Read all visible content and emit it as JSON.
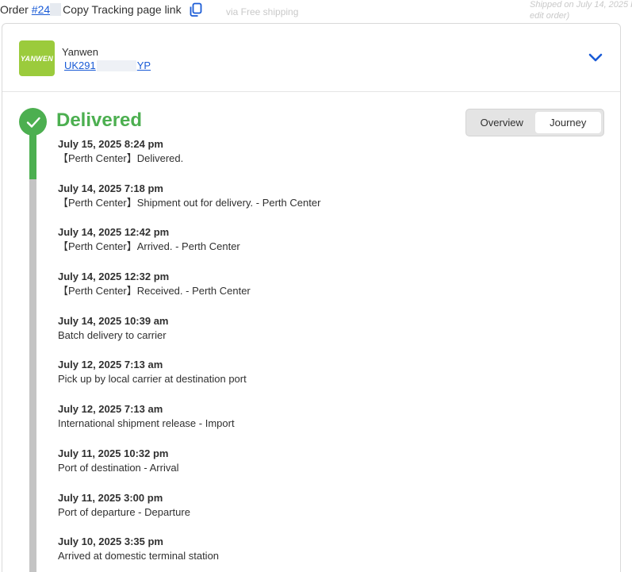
{
  "topbar": {
    "order_label": "Order",
    "order_number": "#24",
    "copy_label": "Copy Tracking page link",
    "copy_icon": "copy-icon"
  },
  "background": {
    "shipping_hint": "via Free shipping",
    "shipped_line1": "Shipped on July 14, 2025 by",
    "shipped_line2": "edit order)"
  },
  "carrier": {
    "logo_text": "YANWEN",
    "name": "Yanwen",
    "tracking_prefix": "UK291",
    "tracking_suffix": "YP",
    "accent_color": "#9bcb3c"
  },
  "status": {
    "title": "Delivered",
    "color": "#4caf50",
    "icon": "check-icon"
  },
  "view_toggle": {
    "overview": "Overview",
    "journey": "Journey",
    "selected": "Journey"
  },
  "events": [
    {
      "time": "July 15, 2025 8:24 pm",
      "desc": "【Perth Center】Delivered."
    },
    {
      "time": "July 14, 2025 7:18 pm",
      "desc": "【Perth Center】Shipment out for delivery. - Perth Center"
    },
    {
      "time": "July 14, 2025 12:42 pm",
      "desc": "【Perth Center】Arrived. - Perth Center"
    },
    {
      "time": "July 14, 2025 12:32 pm",
      "desc": "【Perth Center】Received. - Perth Center"
    },
    {
      "time": "July 14, 2025 10:39 am",
      "desc": "Batch delivery to carrier"
    },
    {
      "time": "July 12, 2025 7:13 am",
      "desc": "Pick up by local carrier at destination port"
    },
    {
      "time": "July 12, 2025 7:13 am",
      "desc": "International shipment release - Import"
    },
    {
      "time": "July 11, 2025 10:32 pm",
      "desc": "Port of destination - Arrival"
    },
    {
      "time": "July 11, 2025 3:00 pm",
      "desc": "Port of departure - Departure"
    },
    {
      "time": "July 10, 2025 3:35 pm",
      "desc": "Arrived at domestic terminal station"
    }
  ]
}
